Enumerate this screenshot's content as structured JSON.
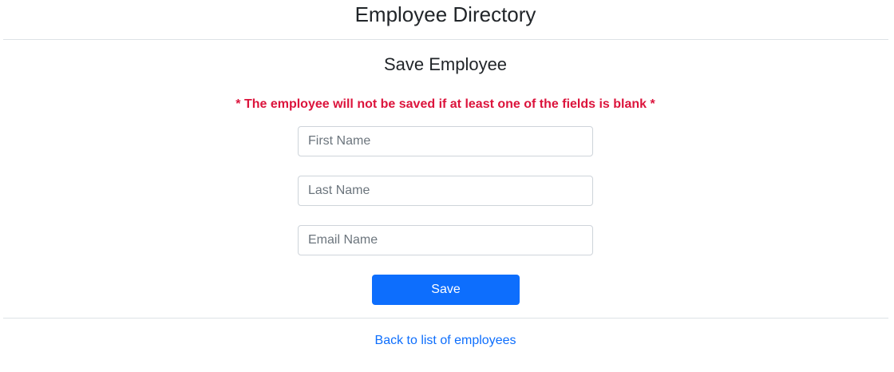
{
  "header": {
    "title": "Employee Directory"
  },
  "form": {
    "title": "Save Employee",
    "warning": "* The employee will not be saved if at least one of the fields is blank *",
    "fields": {
      "first_name": {
        "placeholder": "First Name",
        "value": ""
      },
      "last_name": {
        "placeholder": "Last Name",
        "value": ""
      },
      "email": {
        "placeholder": "Email Name",
        "value": ""
      }
    },
    "save_label": "Save"
  },
  "footer": {
    "back_link_label": "Back to list of employees"
  },
  "colors": {
    "primary": "#0d6efd",
    "warning": "#dc143c",
    "divider": "#dee2e6"
  }
}
